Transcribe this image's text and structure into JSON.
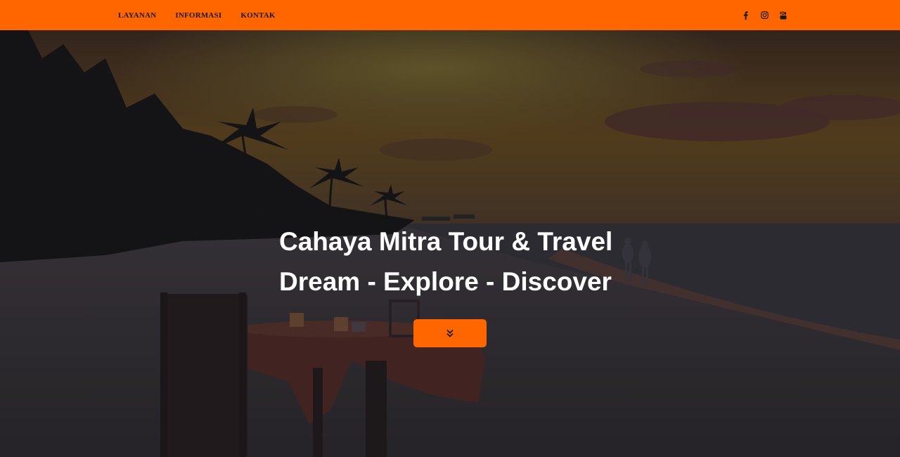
{
  "nav": {
    "items": [
      {
        "label": "LAYANAN"
      },
      {
        "label": "INFORMASI"
      },
      {
        "label": "KONTAK"
      }
    ],
    "social": [
      {
        "icon": "facebook-icon"
      },
      {
        "icon": "instagram-icon"
      },
      {
        "icon": "youtube-icon"
      }
    ]
  },
  "hero": {
    "title_line1": "Cahaya Mitra Tour & Travel",
    "title_line2": "Dream - Explore - Discover",
    "button_icon": "double-chevron-down-icon"
  },
  "colors": {
    "accent": "#ff6600",
    "nav_text": "#1a1a1a",
    "hero_text": "#ffffff"
  }
}
